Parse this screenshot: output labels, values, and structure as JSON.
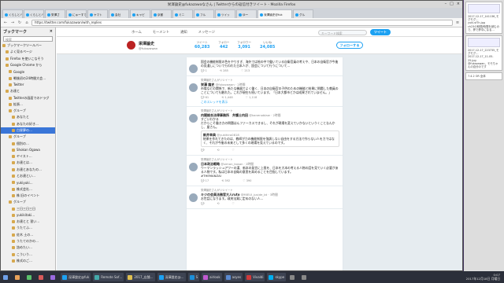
{
  "window": {
    "title": "栄澤論史@fukazawaなさん | Twitterからの返信付きツイート - Mozilla Firefox"
  },
  "tabs": [
    "くらしとバ",
    "くらしとバ",
    "栄澤さ",
    "にゅーすで",
    "ヤマト",
    "会社",
    "キャピ",
    "京都",
    "ミニ",
    "フル",
    "ツイッ",
    "ゆー",
    "深澤論史@fuk",
    "グル"
  ],
  "navbar": {
    "url": "https://twitter.com/fukazawan/with_replies"
  },
  "sidebar": {
    "title": "ブックマーク",
    "search_placeholder": "検索",
    "items": [
      "ブックマークツールバー",
      "よく見るページ",
      "Firefox を使いこなそう",
      "Google Chrome から",
      "Google",
      "戦後初の24時間大会…",
      "Twitter",
      "お達と",
      "Twitterの画面でのドラグ",
      "拡張…",
      "グループ",
      "あなたと",
      "あなたの好き…",
      "白昼夢の…",
      "グループ",
      "個別の…",
      "Shokan Ogawa",
      "ヤイスト…",
      "お達とは…",
      "お達とあなたの…",
      "とお達とい…",
      "yukiyuki…",
      "株式会社…",
      "株 旧のイベント",
      "グループ",
      "三日三日三日",
      "yukikitaki…",
      "お達とと 習い…",
      "うたてふ…",
      "佐木 土の…",
      "うたてのかの…",
      "詰めたい…",
      "こういう…",
      "株式のご…"
    ],
    "selected_index": 13
  },
  "twitter": {
    "nav": [
      "ホーム",
      "モーメント",
      "通知",
      "メッセージ"
    ],
    "search_placeholder": "キーワード検索",
    "tweet_button": "ツイート",
    "profile": {
      "name": "栄澤論史",
      "handle": "@fukazawan"
    },
    "stats": [
      {
        "label": "ツイート",
        "value": "60,283"
      },
      {
        "label": "フォロー",
        "value": "442"
      },
      {
        "label": "フォロワー",
        "value": "3,091"
      },
      {
        "label": "いいね",
        "value": "24,085"
      }
    ],
    "follow_button": "フォローする",
    "tweets": [
      {
        "rt": "",
        "name": "",
        "handle": "",
        "text": "国会の機能制限の色をやりすぎ、海外では絵の中で働いている自衛官員の考えや、日本の自衛官が今後の見通しについて行われた日本人が、国会について行うについて…",
        "acts": [
          "1",
          "285",
          "213"
        ]
      },
      {
        "rt": "栄澤論史さんがリツイート",
        "name": "栄澤 論史",
        "handle": "@fukazawan · 2時間",
        "text": "市場などの関係で、新たな機器でよく働く、日本の自衛官の子供のための機能と結果に問題した教員のことについても触れた。これが現在も続いています。「日本大都市とかは成果されていません。」",
        "acts": [
          "61",
          "1,448",
          "1,118"
        ],
        "link": "このスレッドを表示"
      },
      {
        "rt": "栄澤論史さんがリツイート",
        "name": "内閣総合法律事務所　弁護士内田",
        "handle": "@kanenoblaw · 2時間",
        "text": "すごいわかる\nだからこそ働き方の問題はんファーカスできるし、それが現場を変えていかないというくことなんかし、屋さん。",
        "quote_name": "新井幸典",
        "quote_handle": "@yukihiro0818",
        "quote_text": "結果を作れてきたのは、教師が力の機能制限を強調しない自由をする方法で作らない人を力ではなく、それが今後の未来として多くの現場を見えているのです。",
        "acts": [
          "",
          "",
          ""
        ]
      },
      {
        "rt": "栄澤論史さんがリツイート",
        "name": "日本政治戦略",
        "handle": "@simon_kosan · 2時間",
        "text": "ウーマンラッシュアワーの漢、新本の発言に上限を、日本を大本の考える人物の話を見ていく必要がある人物です。私は日本の自衛の意思を高めることを目指しています。\n#THEMANZAI",
        "acts": [
          "17",
          "392",
          "390"
        ]
      },
      {
        "rt": "栄澤論史さんがリツイート",
        "name": "キジの会員法務官大人ruto",
        "handle": "@MIEUI_juside_bt · 3時間",
        "text": "お世話になります。政府法案に定めのない人…",
        "acts": [
          "",
          "",
          ""
        ]
      }
    ]
  },
  "notifications": [
    {
      "title": "2017-12-17_141136_モグモグ…",
      "body": "yuki-sf7h.jpg",
      "detail": "ch23の時間/時間を読むので、夢で夢中になる…"
    },
    {
      "title": "2017-12-17_223735_モグモグ…",
      "body": "2017-12-17_11-05-25.jpg",
      "detail": "@fukazawan、モモちゃんの自分のです"
    },
    {
      "title": "7.4.2 OR 全体",
      "body": "",
      "detail": ""
    }
  ],
  "taskbar": {
    "items": [
      "",
      "",
      "",
      "",
      "",
      "深澤論史@fuk",
      "Remote Sof…",
      "2017_店舗…",
      "深澤論史@…",
      "S",
      "airlook",
      "asyes",
      "Vivaldi",
      "skype",
      "",
      ""
    ],
    "clock_time": "0:07",
    "clock_date": "2017年12月18日 月曜日"
  },
  "colors": {
    "accent": "#1da1f2",
    "selected": "#3a76d8",
    "taskbar": "#2b2f3a"
  }
}
